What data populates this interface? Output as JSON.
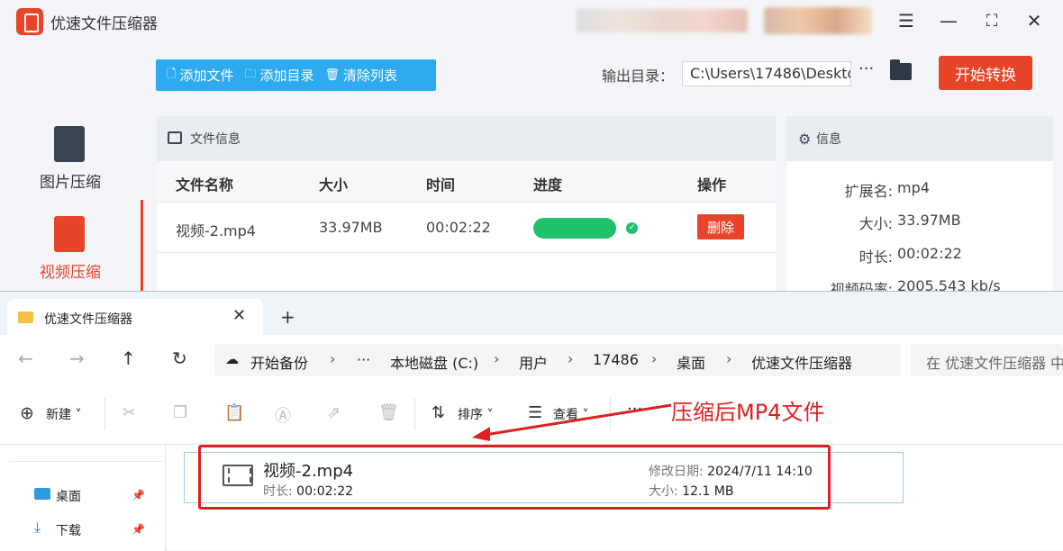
{
  "app": {
    "title": "优速文件压缩器",
    "sidebar": [
      {
        "label": "图片压缩",
        "icon": "image-file-icon",
        "color": "#3a4556"
      },
      {
        "label": "视频压缩",
        "icon": "video-file-icon",
        "color": "#e8442a",
        "active": true
      }
    ],
    "toolbar": {
      "add_file": "添加文件",
      "add_dir": "添加目录",
      "clear_list": "清除列表"
    },
    "output": {
      "label": "输出目录：",
      "path": "C:\\Users\\17486\\Deskto",
      "more": "···",
      "start_button": "开始转换"
    },
    "file_info": {
      "title": "文件信息",
      "columns": [
        "文件名称",
        "大小",
        "时间",
        "进度",
        "操作"
      ],
      "rows": [
        {
          "name": "视频-2.mp4",
          "size": "33.97MB",
          "time": "00:02:22",
          "progress": 1.0,
          "action": "删除"
        }
      ]
    },
    "info_panel": {
      "title": "信息",
      "rows": [
        {
          "key": "扩展名:",
          "value": "mp4"
        },
        {
          "key": "大小:",
          "value": "33.97MB"
        },
        {
          "key": "时长:",
          "value": "00:02:22"
        },
        {
          "key": "视频码率:",
          "value": "2005.543 kb/s"
        }
      ]
    },
    "colors": {
      "accent": "#e8442a",
      "toolbar_blue": "#2eaaf0",
      "progress_green": "#1fc16b"
    }
  },
  "explorer": {
    "tab": {
      "label": "优速文件压缩器",
      "close": "✕",
      "add": "+"
    },
    "nav": {
      "back": "←",
      "forward": "→",
      "up": "↑",
      "refresh": "↻"
    },
    "breadcrumb": {
      "backup": "开始备份",
      "more": "···",
      "items": [
        "本地磁盘 (C:)",
        "用户",
        "17486",
        "桌面",
        "优速文件压缩器"
      ]
    },
    "search_placeholder": "在 优速文件压缩器 中",
    "commands": {
      "new": "新建",
      "sort": "排序",
      "view": "查看",
      "more": "···"
    },
    "navpane": [
      {
        "label": "桌面",
        "icon": "desktop-icon"
      },
      {
        "label": "下载",
        "icon": "download-icon"
      }
    ],
    "file": {
      "name": "视频-2.mp4",
      "duration_label": "时长:",
      "duration": "00:02:22",
      "modified_label": "修改日期:",
      "modified": "2024/7/11 14:10",
      "size_label": "大小:",
      "size": "12.1 MB"
    }
  },
  "annotation": {
    "text": "压缩后MP4文件",
    "color": "#e02020"
  }
}
